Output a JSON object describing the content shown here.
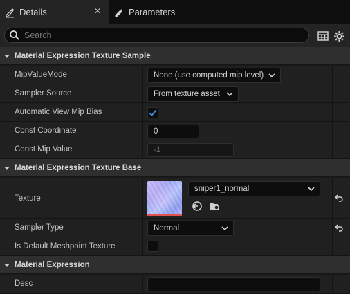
{
  "tabs": [
    {
      "label": "Details",
      "active": true
    },
    {
      "label": "Parameters",
      "active": false
    }
  ],
  "search": {
    "placeholder": "Search",
    "value": ""
  },
  "sections": [
    {
      "title": "Material Expression Texture Sample",
      "rows": [
        {
          "label": "MipValueMode",
          "value": "None (use computed mip level)"
        },
        {
          "label": "Sampler Source",
          "value": "From texture asset"
        },
        {
          "label": "Automatic View Mip Bias",
          "checked": true
        },
        {
          "label": "Const Coordinate",
          "value": "0"
        },
        {
          "label": "Const Mip Value",
          "value": "-1"
        }
      ]
    },
    {
      "title": "Material Expression Texture Base",
      "rows": [
        {
          "label": "Texture",
          "value": "sniper1_normal"
        },
        {
          "label": "Sampler Type",
          "value": "Normal"
        },
        {
          "label": "Is Default Meshpaint Texture",
          "checked": false
        }
      ]
    },
    {
      "title": "Material Expression",
      "rows": [
        {
          "label": "Desc",
          "value": ""
        }
      ]
    }
  ],
  "colors": {
    "accent": "#2f7fd6",
    "check": "#3d8ee6"
  }
}
